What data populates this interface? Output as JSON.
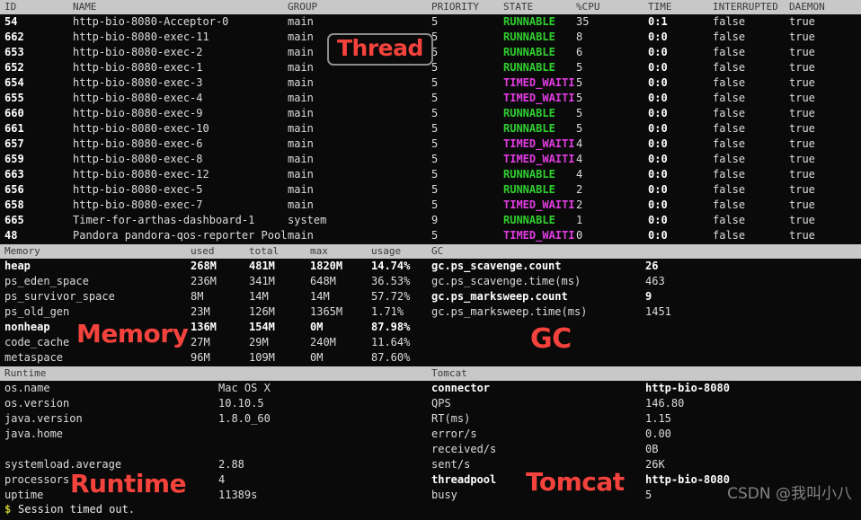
{
  "thread": {
    "section_label": "Thread",
    "columns": [
      "ID",
      "NAME",
      "GROUP",
      "PRIORITY",
      "STATE",
      "%CPU",
      "TIME",
      "INTERRUPTED",
      "DAEMON"
    ],
    "rows": [
      {
        "id": "54",
        "name": "http-bio-8080-Acceptor-0",
        "group": "main",
        "priority": "5",
        "state": "RUNNABLE",
        "cpu": "35",
        "time": "0:1",
        "interrupted": "false",
        "daemon": "true"
      },
      {
        "id": "662",
        "name": "http-bio-8080-exec-11",
        "group": "main",
        "priority": "5",
        "state": "RUNNABLE",
        "cpu": "8",
        "time": "0:0",
        "interrupted": "false",
        "daemon": "true"
      },
      {
        "id": "653",
        "name": "http-bio-8080-exec-2",
        "group": "main",
        "priority": "5",
        "state": "RUNNABLE",
        "cpu": "6",
        "time": "0:0",
        "interrupted": "false",
        "daemon": "true"
      },
      {
        "id": "652",
        "name": "http-bio-8080-exec-1",
        "group": "main",
        "priority": "5",
        "state": "RUNNABLE",
        "cpu": "5",
        "time": "0:0",
        "interrupted": "false",
        "daemon": "true"
      },
      {
        "id": "654",
        "name": "http-bio-8080-exec-3",
        "group": "main",
        "priority": "5",
        "state": "TIMED_WAITI",
        "cpu": "5",
        "time": "0:0",
        "interrupted": "false",
        "daemon": "true"
      },
      {
        "id": "655",
        "name": "http-bio-8080-exec-4",
        "group": "main",
        "priority": "5",
        "state": "TIMED_WAITI",
        "cpu": "5",
        "time": "0:0",
        "interrupted": "false",
        "daemon": "true"
      },
      {
        "id": "660",
        "name": "http-bio-8080-exec-9",
        "group": "main",
        "priority": "5",
        "state": "RUNNABLE",
        "cpu": "5",
        "time": "0:0",
        "interrupted": "false",
        "daemon": "true"
      },
      {
        "id": "661",
        "name": "http-bio-8080-exec-10",
        "group": "main",
        "priority": "5",
        "state": "RUNNABLE",
        "cpu": "5",
        "time": "0:0",
        "interrupted": "false",
        "daemon": "true"
      },
      {
        "id": "657",
        "name": "http-bio-8080-exec-6",
        "group": "main",
        "priority": "5",
        "state": "TIMED_WAITI",
        "cpu": "4",
        "time": "0:0",
        "interrupted": "false",
        "daemon": "true"
      },
      {
        "id": "659",
        "name": "http-bio-8080-exec-8",
        "group": "main",
        "priority": "5",
        "state": "TIMED_WAITI",
        "cpu": "4",
        "time": "0:0",
        "interrupted": "false",
        "daemon": "true"
      },
      {
        "id": "663",
        "name": "http-bio-8080-exec-12",
        "group": "main",
        "priority": "5",
        "state": "RUNNABLE",
        "cpu": "4",
        "time": "0:0",
        "interrupted": "false",
        "daemon": "true"
      },
      {
        "id": "656",
        "name": "http-bio-8080-exec-5",
        "group": "main",
        "priority": "5",
        "state": "RUNNABLE",
        "cpu": "2",
        "time": "0:0",
        "interrupted": "false",
        "daemon": "true"
      },
      {
        "id": "658",
        "name": "http-bio-8080-exec-7",
        "group": "main",
        "priority": "5",
        "state": "TIMED_WAITI",
        "cpu": "2",
        "time": "0:0",
        "interrupted": "false",
        "daemon": "true"
      },
      {
        "id": "665",
        "name": "Timer-for-arthas-dashboard-1",
        "group": "system",
        "priority": "9",
        "state": "RUNNABLE",
        "cpu": "1",
        "time": "0:0",
        "interrupted": "false",
        "daemon": "true"
      },
      {
        "id": "48",
        "name": "Pandora pandora-qos-reporter Pool",
        "group": "main",
        "priority": "5",
        "state": "TIMED_WAITI",
        "cpu": "0",
        "time": "0:0",
        "interrupted": "false",
        "daemon": "true"
      }
    ]
  },
  "memory": {
    "section_label": "Memory",
    "columns": [
      "Memory",
      "used",
      "total",
      "max",
      "usage"
    ],
    "rows": [
      {
        "name": "heap",
        "used": "268M",
        "total": "481M",
        "max": "1820M",
        "usage": "14.74%",
        "bold": true
      },
      {
        "name": "ps_eden_space",
        "used": "236M",
        "total": "341M",
        "max": "648M",
        "usage": "36.53%",
        "bold": false
      },
      {
        "name": "ps_survivor_space",
        "used": "8M",
        "total": "14M",
        "max": "14M",
        "usage": "57.72%",
        "bold": false
      },
      {
        "name": "ps_old_gen",
        "used": "23M",
        "total": "126M",
        "max": "1365M",
        "usage": "1.71%",
        "bold": false
      },
      {
        "name": "nonheap",
        "used": "136M",
        "total": "154M",
        "max": "0M",
        "usage": "87.98%",
        "bold": true
      },
      {
        "name": "code_cache",
        "used": "27M",
        "total": "29M",
        "max": "240M",
        "usage": "11.64%",
        "bold": false
      },
      {
        "name": "metaspace",
        "used": "96M",
        "total": "109M",
        "max": "0M",
        "usage": "87.60%",
        "bold": false
      }
    ]
  },
  "gc": {
    "section_label": "GC",
    "rows": [
      {
        "name": "gc.ps_scavenge.count",
        "value": "26",
        "bold": true
      },
      {
        "name": "gc.ps_scavenge.time(ms)",
        "value": "463",
        "bold": false
      },
      {
        "name": "gc.ps_marksweep.count",
        "value": "9",
        "bold": true
      },
      {
        "name": "gc.ps_marksweep.time(ms)",
        "value": "1451",
        "bold": false
      }
    ]
  },
  "runtime": {
    "section_label": "Runtime",
    "rows": [
      {
        "name": "os.name",
        "value": "Mac OS X"
      },
      {
        "name": "os.version",
        "value": "10.10.5"
      },
      {
        "name": "java.version",
        "value": "1.8.0_60"
      },
      {
        "name": "java.home",
        "value": ""
      },
      {
        "name": "",
        "value": ""
      },
      {
        "name": "systemload.average",
        "value": "2.88"
      },
      {
        "name": "processors",
        "value": "4"
      },
      {
        "name": "uptime",
        "value": "11389s"
      }
    ]
  },
  "tomcat": {
    "section_label": "Tomcat",
    "rows": [
      {
        "name": "connector",
        "value": "http-bio-8080",
        "bold": true
      },
      {
        "name": "QPS",
        "value": "146.80",
        "bold": false
      },
      {
        "name": "RT(ms)",
        "value": "1.15",
        "bold": false
      },
      {
        "name": "error/s",
        "value": "0.00",
        "bold": false
      },
      {
        "name": "received/s",
        "value": "0B",
        "bold": false
      },
      {
        "name": "sent/s",
        "value": "26K",
        "bold": false
      },
      {
        "name": "threadpool",
        "value": "http-bio-8080",
        "bold": true
      },
      {
        "name": "busy",
        "value": "5",
        "bold": false
      }
    ]
  },
  "prompt": {
    "sigil": "$",
    "text": "Session timed out."
  },
  "annotations": {
    "thread": "Thread",
    "memory": "Memory",
    "gc": "GC",
    "runtime": "Runtime",
    "tomcat": "Tomcat",
    "color": "#f4423c"
  },
  "watermark": "CSDN @我叫小八",
  "palette": {
    "background": "#0a0a0a",
    "header_bar": "#c8c8c8",
    "header_text": "#3a3a3a",
    "runnable": "#2fd02f",
    "timed_waiting": "#e23ce2",
    "value_text": "#ffffff",
    "prompt_sigil": "#c8c832"
  }
}
